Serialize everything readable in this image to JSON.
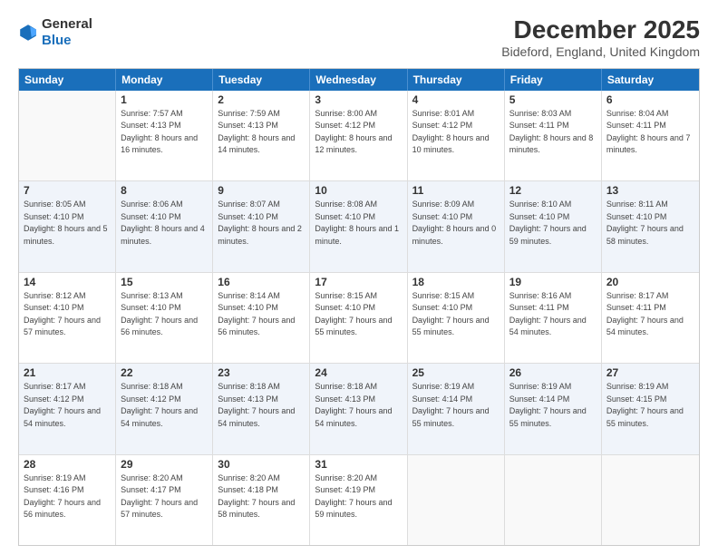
{
  "header": {
    "logo_general": "General",
    "logo_blue": "Blue",
    "main_title": "December 2025",
    "subtitle": "Bideford, England, United Kingdom"
  },
  "weekdays": [
    "Sunday",
    "Monday",
    "Tuesday",
    "Wednesday",
    "Thursday",
    "Friday",
    "Saturday"
  ],
  "rows": [
    [
      {
        "day": "",
        "sunrise": "",
        "sunset": "",
        "daylight": "",
        "empty": true
      },
      {
        "day": "1",
        "sunrise": "Sunrise: 7:57 AM",
        "sunset": "Sunset: 4:13 PM",
        "daylight": "Daylight: 8 hours and 16 minutes."
      },
      {
        "day": "2",
        "sunrise": "Sunrise: 7:59 AM",
        "sunset": "Sunset: 4:13 PM",
        "daylight": "Daylight: 8 hours and 14 minutes."
      },
      {
        "day": "3",
        "sunrise": "Sunrise: 8:00 AM",
        "sunset": "Sunset: 4:12 PM",
        "daylight": "Daylight: 8 hours and 12 minutes."
      },
      {
        "day": "4",
        "sunrise": "Sunrise: 8:01 AM",
        "sunset": "Sunset: 4:12 PM",
        "daylight": "Daylight: 8 hours and 10 minutes."
      },
      {
        "day": "5",
        "sunrise": "Sunrise: 8:03 AM",
        "sunset": "Sunset: 4:11 PM",
        "daylight": "Daylight: 8 hours and 8 minutes."
      },
      {
        "day": "6",
        "sunrise": "Sunrise: 8:04 AM",
        "sunset": "Sunset: 4:11 PM",
        "daylight": "Daylight: 8 hours and 7 minutes."
      }
    ],
    [
      {
        "day": "7",
        "sunrise": "Sunrise: 8:05 AM",
        "sunset": "Sunset: 4:10 PM",
        "daylight": "Daylight: 8 hours and 5 minutes."
      },
      {
        "day": "8",
        "sunrise": "Sunrise: 8:06 AM",
        "sunset": "Sunset: 4:10 PM",
        "daylight": "Daylight: 8 hours and 4 minutes."
      },
      {
        "day": "9",
        "sunrise": "Sunrise: 8:07 AM",
        "sunset": "Sunset: 4:10 PM",
        "daylight": "Daylight: 8 hours and 2 minutes."
      },
      {
        "day": "10",
        "sunrise": "Sunrise: 8:08 AM",
        "sunset": "Sunset: 4:10 PM",
        "daylight": "Daylight: 8 hours and 1 minute."
      },
      {
        "day": "11",
        "sunrise": "Sunrise: 8:09 AM",
        "sunset": "Sunset: 4:10 PM",
        "daylight": "Daylight: 8 hours and 0 minutes."
      },
      {
        "day": "12",
        "sunrise": "Sunrise: 8:10 AM",
        "sunset": "Sunset: 4:10 PM",
        "daylight": "Daylight: 7 hours and 59 minutes."
      },
      {
        "day": "13",
        "sunrise": "Sunrise: 8:11 AM",
        "sunset": "Sunset: 4:10 PM",
        "daylight": "Daylight: 7 hours and 58 minutes."
      }
    ],
    [
      {
        "day": "14",
        "sunrise": "Sunrise: 8:12 AM",
        "sunset": "Sunset: 4:10 PM",
        "daylight": "Daylight: 7 hours and 57 minutes."
      },
      {
        "day": "15",
        "sunrise": "Sunrise: 8:13 AM",
        "sunset": "Sunset: 4:10 PM",
        "daylight": "Daylight: 7 hours and 56 minutes."
      },
      {
        "day": "16",
        "sunrise": "Sunrise: 8:14 AM",
        "sunset": "Sunset: 4:10 PM",
        "daylight": "Daylight: 7 hours and 56 minutes."
      },
      {
        "day": "17",
        "sunrise": "Sunrise: 8:15 AM",
        "sunset": "Sunset: 4:10 PM",
        "daylight": "Daylight: 7 hours and 55 minutes."
      },
      {
        "day": "18",
        "sunrise": "Sunrise: 8:15 AM",
        "sunset": "Sunset: 4:10 PM",
        "daylight": "Daylight: 7 hours and 55 minutes."
      },
      {
        "day": "19",
        "sunrise": "Sunrise: 8:16 AM",
        "sunset": "Sunset: 4:11 PM",
        "daylight": "Daylight: 7 hours and 54 minutes."
      },
      {
        "day": "20",
        "sunrise": "Sunrise: 8:17 AM",
        "sunset": "Sunset: 4:11 PM",
        "daylight": "Daylight: 7 hours and 54 minutes."
      }
    ],
    [
      {
        "day": "21",
        "sunrise": "Sunrise: 8:17 AM",
        "sunset": "Sunset: 4:12 PM",
        "daylight": "Daylight: 7 hours and 54 minutes."
      },
      {
        "day": "22",
        "sunrise": "Sunrise: 8:18 AM",
        "sunset": "Sunset: 4:12 PM",
        "daylight": "Daylight: 7 hours and 54 minutes."
      },
      {
        "day": "23",
        "sunrise": "Sunrise: 8:18 AM",
        "sunset": "Sunset: 4:13 PM",
        "daylight": "Daylight: 7 hours and 54 minutes."
      },
      {
        "day": "24",
        "sunrise": "Sunrise: 8:18 AM",
        "sunset": "Sunset: 4:13 PM",
        "daylight": "Daylight: 7 hours and 54 minutes."
      },
      {
        "day": "25",
        "sunrise": "Sunrise: 8:19 AM",
        "sunset": "Sunset: 4:14 PM",
        "daylight": "Daylight: 7 hours and 55 minutes."
      },
      {
        "day": "26",
        "sunrise": "Sunrise: 8:19 AM",
        "sunset": "Sunset: 4:14 PM",
        "daylight": "Daylight: 7 hours and 55 minutes."
      },
      {
        "day": "27",
        "sunrise": "Sunrise: 8:19 AM",
        "sunset": "Sunset: 4:15 PM",
        "daylight": "Daylight: 7 hours and 55 minutes."
      }
    ],
    [
      {
        "day": "28",
        "sunrise": "Sunrise: 8:19 AM",
        "sunset": "Sunset: 4:16 PM",
        "daylight": "Daylight: 7 hours and 56 minutes."
      },
      {
        "day": "29",
        "sunrise": "Sunrise: 8:20 AM",
        "sunset": "Sunset: 4:17 PM",
        "daylight": "Daylight: 7 hours and 57 minutes."
      },
      {
        "day": "30",
        "sunrise": "Sunrise: 8:20 AM",
        "sunset": "Sunset: 4:18 PM",
        "daylight": "Daylight: 7 hours and 58 minutes."
      },
      {
        "day": "31",
        "sunrise": "Sunrise: 8:20 AM",
        "sunset": "Sunset: 4:19 PM",
        "daylight": "Daylight: 7 hours and 59 minutes."
      },
      {
        "day": "",
        "sunrise": "",
        "sunset": "",
        "daylight": "",
        "empty": true
      },
      {
        "day": "",
        "sunrise": "",
        "sunset": "",
        "daylight": "",
        "empty": true
      },
      {
        "day": "",
        "sunrise": "",
        "sunset": "",
        "daylight": "",
        "empty": true
      }
    ]
  ]
}
